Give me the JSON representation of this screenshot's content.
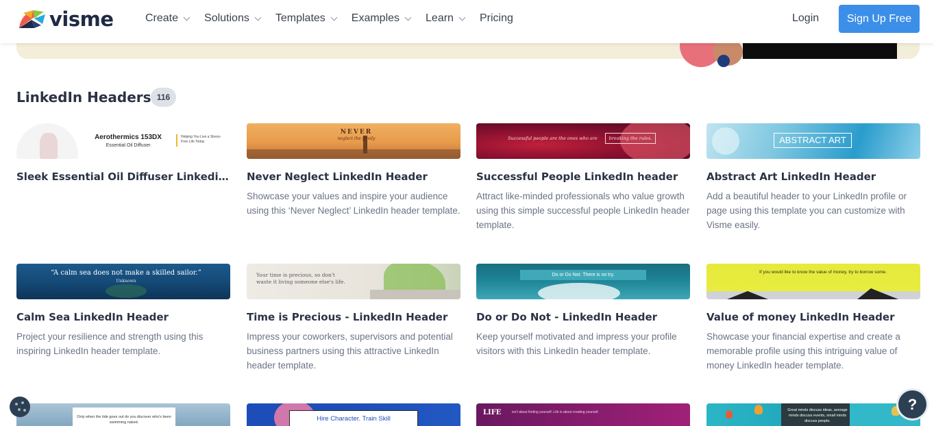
{
  "header": {
    "logo_text": "visme",
    "nav": [
      {
        "label": "Create",
        "has_dropdown": true
      },
      {
        "label": "Solutions",
        "has_dropdown": true
      },
      {
        "label": "Templates",
        "has_dropdown": true
      },
      {
        "label": "Examples",
        "has_dropdown": true
      },
      {
        "label": "Learn",
        "has_dropdown": true
      },
      {
        "label": "Pricing",
        "has_dropdown": false
      }
    ],
    "login_label": "Login",
    "signup_label": "Sign Up Free"
  },
  "section": {
    "title": "LinkedIn Headers",
    "count": "116"
  },
  "cards": [
    {
      "title": "Sleek Essential Oil Diffuser Linkedin...",
      "description": "",
      "thumb_text": "Aerothermics 153DX",
      "thumb_sub": "Essential Oil Diffuser",
      "thumb_side": "Helping You Live a Stress-Free Life Today"
    },
    {
      "title": "Never Neglect LinkedIn Header",
      "description": "Showcase your values and inspire your audience using this ‘Never Neglect’ LinkedIn header template.",
      "thumb_text": "NEVER",
      "thumb_sub": "neglect the family"
    },
    {
      "title": "Successful People LinkedIn header",
      "description": "Attract like-minded professionals who value growth using this simple successful people LinkedIn header template.",
      "thumb_text": "Successful people are the ones who are",
      "thumb_sub": "breaking the rules."
    },
    {
      "title": "Abstract Art LinkedIn Header",
      "description": "Add a beautiful header to your LinkedIn profile or page using this template you can customize with Visme easily.",
      "thumb_text": "ABSTRACT ART"
    },
    {
      "title": "Calm Sea LinkedIn Header",
      "description": "Project your resilience and strength using this inspiring LinkedIn header template.",
      "thumb_text": "“A calm sea does not make a skilled sailor.”",
      "thumb_sub": "Unknown"
    },
    {
      "title": "Time is Precious - LinkedIn Header",
      "description": "Impress your coworkers, supervisors and potential business partners using this attractive LinkedIn header template.",
      "thumb_text": "Your time is precious, so don't waste it living someone else's life."
    },
    {
      "title": "Do or Do Not - LinkedIn Header",
      "description": "Keep yourself motivated and impress your profile visitors with this LinkedIn header template.",
      "thumb_text": "Do or Do Not. There is no try."
    },
    {
      "title": "Value of money LinkedIn Header",
      "description": "Showcase your financial expertise and create a memorable profile using this intriguing value of money LinkedIn header template.",
      "thumb_text": "If you would like to know the value of money, try to borrow some."
    },
    {
      "title": "",
      "description": "",
      "thumb_text": "Only when the tide goes out do you discover who's been swimming naked."
    },
    {
      "title": "",
      "description": "",
      "thumb_text": "Hire Character. Train Skill"
    },
    {
      "title": "",
      "description": "",
      "thumb_text": "LIFE",
      "thumb_sub": "isn't about finding yourself. Life is about creating yourself."
    },
    {
      "title": "",
      "description": "",
      "thumb_text": "Great minds discuss ideas, average minds discuss events, small minds discuss people."
    }
  ],
  "help_label": "?",
  "colors": {
    "accent": "#3c8fe8",
    "banner": "#f3eeda",
    "badge": "#dde1e8",
    "dark": "#2d3f52"
  }
}
